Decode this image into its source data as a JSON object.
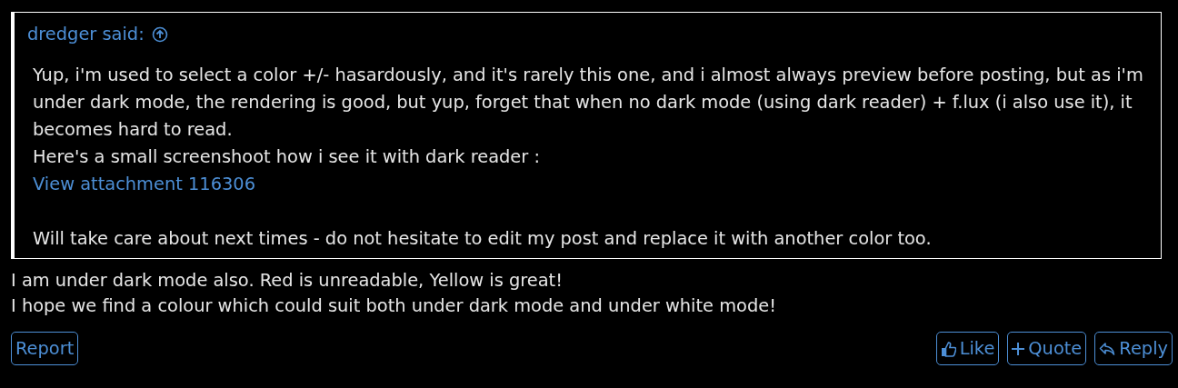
{
  "quote": {
    "author": "dredger said:",
    "paragraphs": [
      {
        "kind": "text",
        "text": "Yup, i'm used to select a color +/- hasardously, and it's rarely this one, and i almost always preview before posting, but as i'm under dark mode, the rendering is good, but yup, forget that when no dark mode (using dark reader) + f.lux (i also use it), it becomes hard to read."
      },
      {
        "kind": "text",
        "text": "Here's a small screenshoot how i see it with dark reader :"
      },
      {
        "kind": "link",
        "text": "View attachment 116306"
      },
      {
        "kind": "gap"
      },
      {
        "kind": "text",
        "text": "Will take care about next times - do not hesitate to edit my post and replace it with another color too."
      }
    ]
  },
  "message": [
    "I am under dark mode also. Red is unreadable, Yellow is great!",
    "I hope we find a colour which could suit both under dark mode and under white mode!"
  ],
  "actions_left": [
    {
      "kind": "report",
      "label": "Report"
    }
  ],
  "actions_right": [
    {
      "kind": "like",
      "label": "Like"
    },
    {
      "kind": "quote",
      "label": "Quote"
    },
    {
      "kind": "reply",
      "label": "Reply"
    }
  ]
}
